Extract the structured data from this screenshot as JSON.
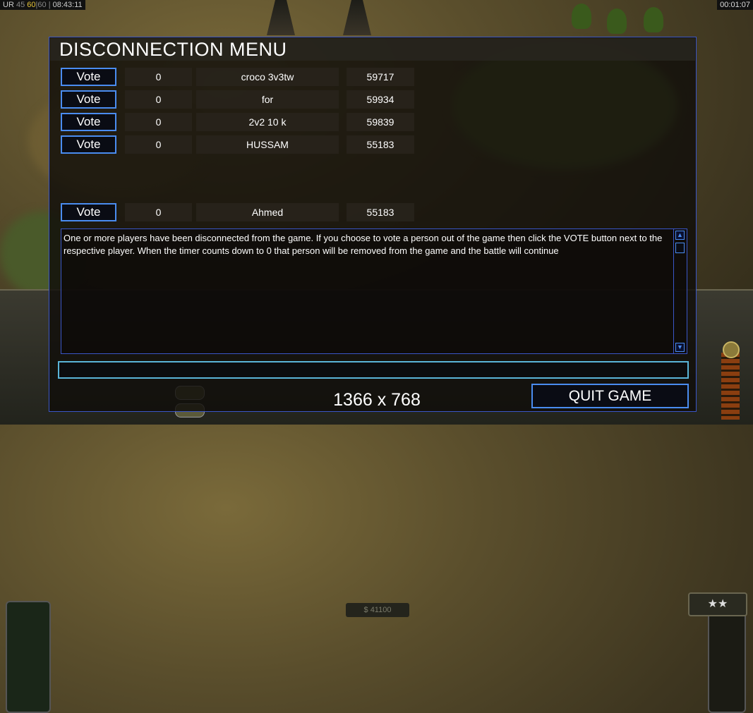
{
  "status_bar": {
    "left_prefix": "UR",
    "left_val1": "45",
    "left_val2": "60",
    "left_val3": "60",
    "left_time": "08:43:11",
    "right_time": "00:01:07"
  },
  "dialog": {
    "title": "DISCONNECTION MENU",
    "vote_label": "Vote",
    "players": [
      {
        "votes": "0",
        "name": "croco 3v3tw",
        "ping": "59717"
      },
      {
        "votes": "0",
        "name": "for",
        "ping": "59934"
      },
      {
        "votes": "0",
        "name": "2v2 10 k",
        "ping": "59839"
      },
      {
        "votes": "0",
        "name": "HUSSAM",
        "ping": "55183"
      }
    ],
    "self_player": {
      "votes": "0",
      "name": "Ahmed",
      "ping": "55183"
    },
    "message": "One or more players have been disconnected from the game. If you choose to vote a person out of the game then click the VOTE button next to the respective player. When the timer counts down to 0 that person will be removed from the game and the battle will continue",
    "chat_value": "",
    "quit_label": "QUIT GAME",
    "resolution": "1366 x 768"
  },
  "hud": {
    "cash": "$ 41100",
    "stars": "★★"
  },
  "colors": {
    "accent_border": "#3a56c8",
    "button_border": "#4a8cf0",
    "input_border": "#5ab4d8",
    "fps_yellow": "#e6c43a"
  }
}
